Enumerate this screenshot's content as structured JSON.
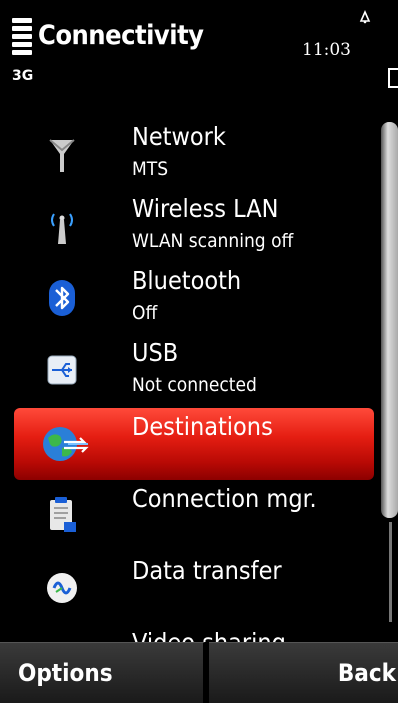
{
  "status": {
    "title": "Connectivity",
    "time": "11:03",
    "network_type": "3G"
  },
  "items": [
    {
      "label": "Network",
      "sub": "MTS",
      "icon": "antenna-icon"
    },
    {
      "label": "Wireless LAN",
      "sub": "WLAN scanning off",
      "icon": "wlan-icon"
    },
    {
      "label": "Bluetooth",
      "sub": "Off",
      "icon": "bluetooth-icon"
    },
    {
      "label": "USB",
      "sub": "Not connected",
      "icon": "usb-icon"
    },
    {
      "label": "Destinations",
      "sub": "",
      "icon": "globe-icon"
    },
    {
      "label": "Connection mgr.",
      "sub": "",
      "icon": "clipboard-icon"
    },
    {
      "label": "Data transfer",
      "sub": "",
      "icon": "sync-icon"
    },
    {
      "label": "Video sharing",
      "sub": "",
      "icon": "video-icon"
    }
  ],
  "softkeys": {
    "left": "Options",
    "right": "Back"
  },
  "colors": {
    "selection": "#e51e12",
    "background": "#000000"
  }
}
